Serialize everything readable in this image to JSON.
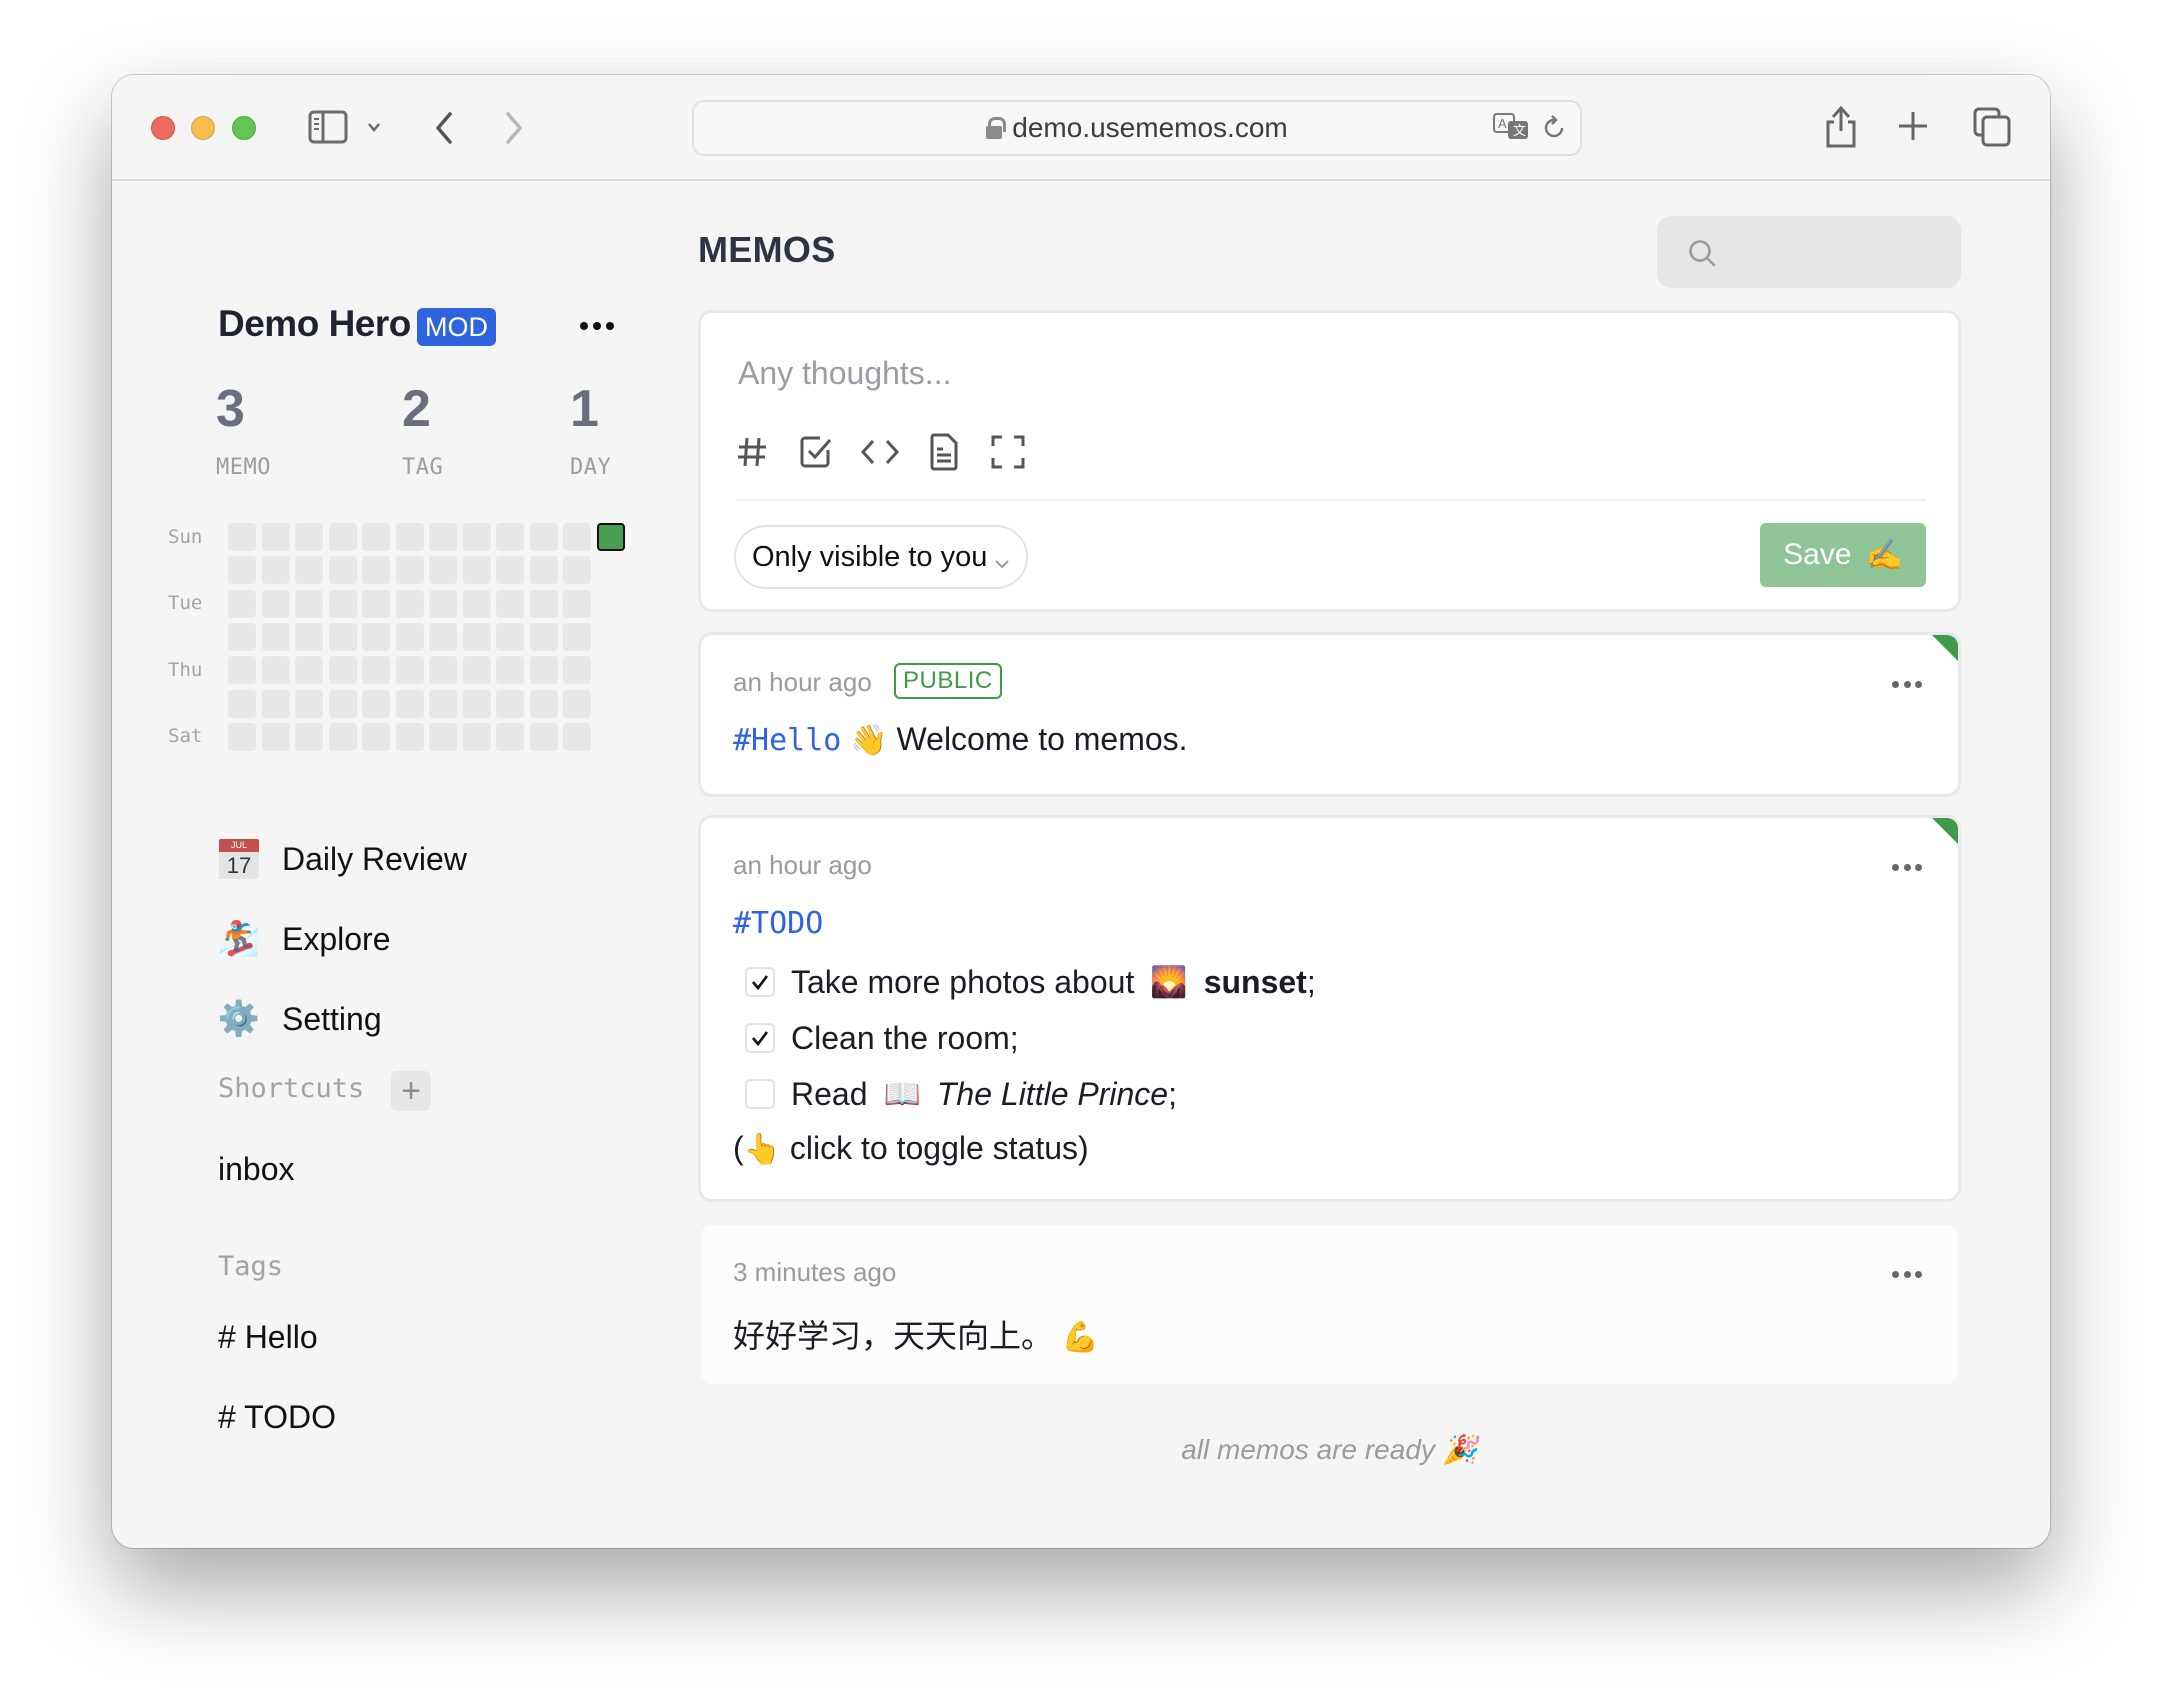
{
  "browser": {
    "url": "demo.usememos.com",
    "icons": [
      "sidebar-toggle-icon",
      "chevron-down-icon",
      "back-icon",
      "forward-icon",
      "lock-icon",
      "translate-icon",
      "reload-icon",
      "share-icon",
      "new-tab-icon",
      "tab-overview-icon"
    ]
  },
  "sidebar": {
    "user_name": "Demo Hero",
    "role_badge": "MOD",
    "stats": [
      {
        "value": "3",
        "label": "MEMO"
      },
      {
        "value": "2",
        "label": "TAG"
      },
      {
        "value": "1",
        "label": "DAY"
      }
    ],
    "heatmap": {
      "day_labels": [
        "Sun",
        "Tue",
        "Thu",
        "Sat"
      ],
      "weeks_full": 11,
      "active_cells": [
        {
          "week": 12,
          "day": "Sun",
          "count": 1
        }
      ],
      "active_color": "#4a9e54"
    },
    "nav": [
      {
        "label": "Daily Review",
        "icon": "calendar-icon",
        "icon_text_month": "JUL",
        "icon_text_day": "17"
      },
      {
        "label": "Explore",
        "icon": "snowboarder-icon",
        "emoji": "🏂"
      },
      {
        "label": "Setting",
        "icon": "gear-icon",
        "emoji": "⚙️"
      }
    ],
    "shortcuts_title": "Shortcuts",
    "shortcuts": [
      "inbox"
    ],
    "tags_title": "Tags",
    "tags": [
      "# Hello",
      "# TODO"
    ]
  },
  "main": {
    "title": "MEMOS",
    "search_placeholder": "",
    "editor": {
      "placeholder": "Any thoughts...",
      "tools": [
        "tag-icon",
        "checkbox-icon",
        "code-icon",
        "document-icon",
        "fullscreen-icon"
      ],
      "visibility": "Only visible to you",
      "save_label": "Save",
      "save_emoji": "✍️"
    },
    "memos": [
      {
        "time": "an hour ago",
        "badge": "PUBLIC",
        "pinned": true,
        "tag": "#Hello",
        "emoji": "👋",
        "text": "Welcome to memos."
      },
      {
        "time": "an hour ago",
        "pinned": true,
        "tag": "#TODO",
        "todos": [
          {
            "checked": true,
            "text": "Take more photos about",
            "emoji": "🌄",
            "bold": "sunset",
            "suffix": ";"
          },
          {
            "checked": true,
            "text": "Clean the room;"
          },
          {
            "checked": false,
            "text": "Read",
            "emoji": "📖",
            "italic": "The Little Prince",
            "suffix": ";"
          }
        ],
        "note_prefix": "(",
        "note_emoji": "👆",
        "note_text": "click to toggle status)"
      },
      {
        "time": "3 minutes ago",
        "pinned": false,
        "text": "好好学习，天天向上。",
        "emoji": "💪"
      }
    ],
    "footer": "all memos are ready",
    "footer_emoji": "🎉"
  },
  "colors": {
    "accent_blue": "#2f64e0",
    "public_green": "#3f9a4a",
    "save_green": "#8fc596"
  }
}
